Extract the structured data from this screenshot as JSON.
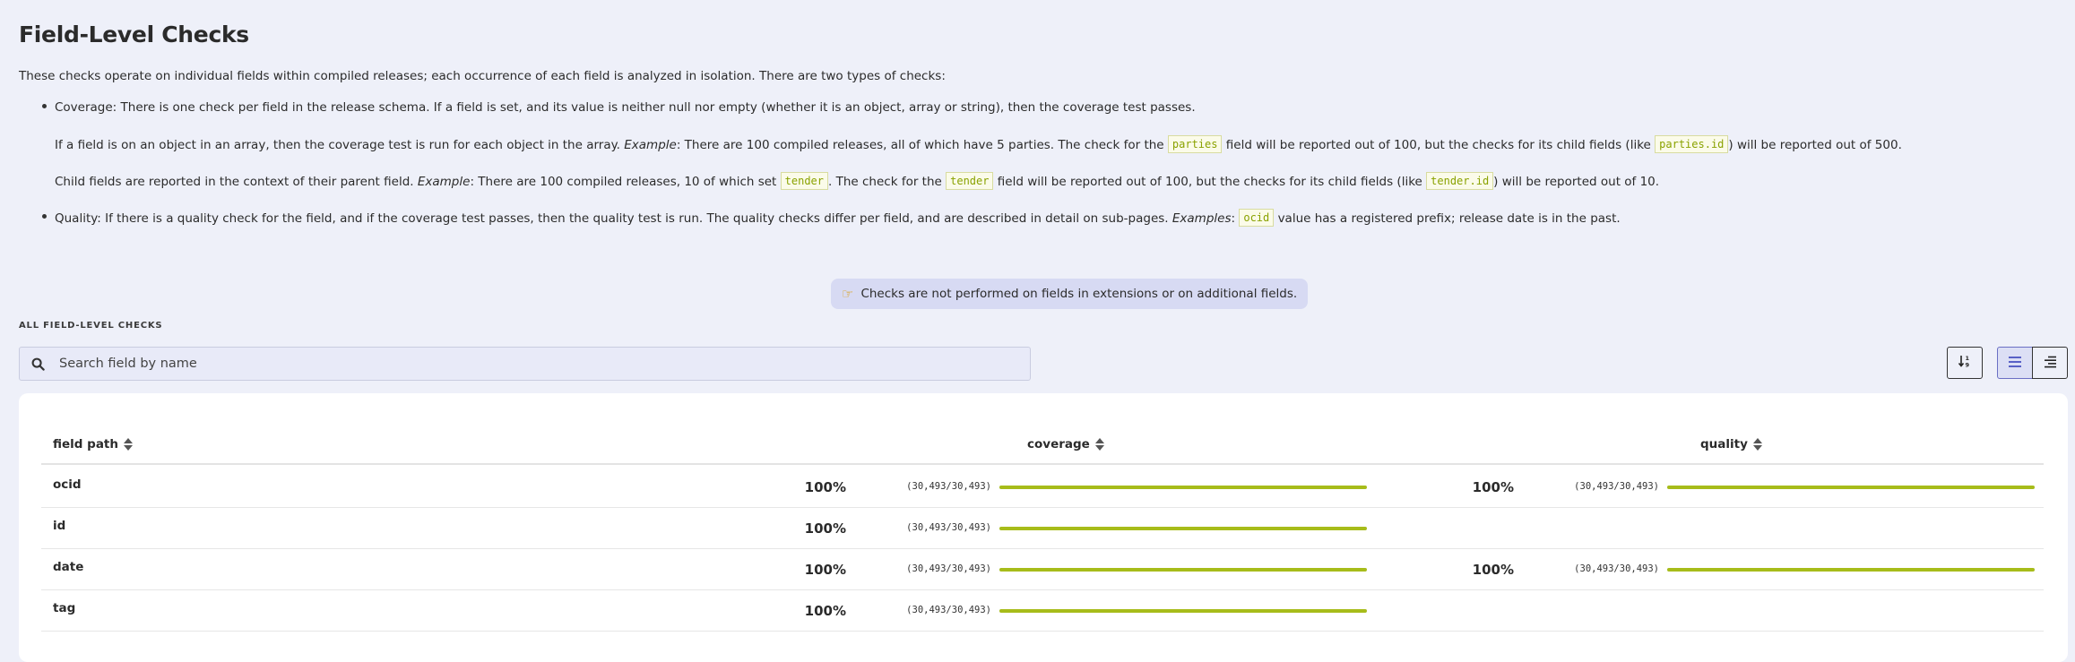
{
  "title": "Field-Level Checks",
  "intro": "These checks operate on individual fields within compiled releases; each occurrence of each field is analyzed in isolation. There are two types of checks:",
  "coverage": {
    "main": "Coverage: There is one check per field in the release schema. If a field is set, and its value is neither null nor empty (whether it is an object, array or string), then the coverage test passes.",
    "p1_a": "If a field is on an object in an array, then the coverage test is run for each object in the array.",
    "p1_example": "Example",
    "p1_b": ": There are 100 compiled releases, all of which have 5 parties. The check for the",
    "p1_code1": "parties",
    "p1_c": "field will be reported out of 100, but the checks for its child fields (like",
    "p1_code2": "parties.id",
    "p1_d": ") will be reported out of 500.",
    "p2_a": "Child fields are reported in the context of their parent field.",
    "p2_example": "Example",
    "p2_b": ": There are 100 compiled releases, 10 of which set",
    "p2_code1": "tender",
    "p2_c": ". The check for the",
    "p2_code2": "tender",
    "p2_d": "field will be reported out of 100, but the checks for its child fields (like",
    "p2_code3": "tender.id",
    "p2_e": ") will be reported out of 10."
  },
  "quality": {
    "a": "Quality: If there is a quality check for the field, and if the coverage test passes, then the quality test is run. The quality checks differ per field, and are described in detail on sub-pages.",
    "example": "Examples",
    "b": ":",
    "code": "ocid",
    "c": "value has a registered prefix; release date is in the past."
  },
  "note": {
    "icon": "pointing-hand-icon",
    "text": "Checks are not performed on fields in extensions or on additional fields."
  },
  "section_label": "ALL FIELD-LEVEL CHECKS",
  "search": {
    "placeholder": "Search field by name",
    "icon": "search-icon"
  },
  "toolbar": {
    "sort_icon": "sort-numeric-icon",
    "list_icon": "list-view-icon",
    "bars_icon": "align-right-view-icon"
  },
  "table": {
    "headers": {
      "field_path": "field path",
      "coverage": "coverage",
      "quality": "quality"
    },
    "rows": [
      {
        "name": "ocid",
        "coverage_pct": "100%",
        "coverage_count": "(30,493/30,493)",
        "coverage_fill": 1.0,
        "quality_pct": "100%",
        "quality_count": "(30,493/30,493)",
        "quality_fill": 1.0
      },
      {
        "name": "id",
        "coverage_pct": "100%",
        "coverage_count": "(30,493/30,493)",
        "coverage_fill": 1.0
      },
      {
        "name": "date",
        "coverage_pct": "100%",
        "coverage_count": "(30,493/30,493)",
        "coverage_fill": 1.0,
        "quality_pct": "100%",
        "quality_count": "(30,493/30,493)",
        "quality_fill": 1.0
      },
      {
        "name": "tag",
        "coverage_pct": "100%",
        "coverage_count": "(30,493/30,493)",
        "coverage_fill": 1.0
      }
    ]
  },
  "colors": {
    "accent": "#a7bc1a",
    "background": "#eef0f9",
    "code": "#8aa200"
  }
}
